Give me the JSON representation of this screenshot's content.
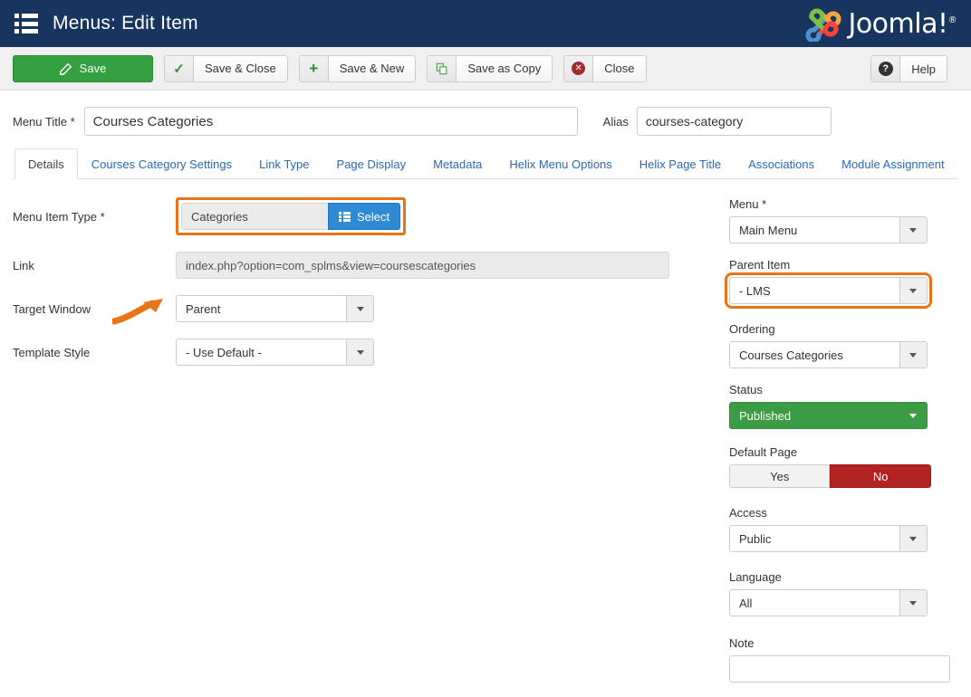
{
  "header": {
    "title": "Menus: Edit Item",
    "menu_icon": "list-icon",
    "brand": "Joomla!",
    "brand_mark": "®"
  },
  "toolbar": {
    "save": "Save",
    "save_close": "Save & Close",
    "save_new": "Save & New",
    "save_copy": "Save as Copy",
    "close": "Close",
    "help": "Help"
  },
  "form": {
    "menu_title_label": "Menu Title *",
    "menu_title_value": "Courses Categories",
    "alias_label": "Alias",
    "alias_value": "courses-category"
  },
  "tabs": [
    {
      "label": "Details",
      "active": true
    },
    {
      "label": "Courses Category Settings",
      "active": false
    },
    {
      "label": "Link Type",
      "active": false
    },
    {
      "label": "Page Display",
      "active": false
    },
    {
      "label": "Metadata",
      "active": false
    },
    {
      "label": "Helix Menu Options",
      "active": false
    },
    {
      "label": "Helix Page Title",
      "active": false
    },
    {
      "label": "Associations",
      "active": false
    },
    {
      "label": "Module Assignment",
      "active": false
    }
  ],
  "details": {
    "menu_item_type_label": "Menu Item Type *",
    "menu_item_type_value": "Categories",
    "select_button": "Select",
    "link_label": "Link",
    "link_value": "index.php?option=com_splms&view=coursescategories",
    "target_window_label": "Target Window",
    "target_window_value": "Parent",
    "template_style_label": "Template Style",
    "template_style_value": "- Use Default -"
  },
  "sidebar": {
    "menu_label": "Menu *",
    "menu_value": "Main Menu",
    "parent_label": "Parent Item",
    "parent_value": "- LMS",
    "ordering_label": "Ordering",
    "ordering_value": "Courses Categories",
    "status_label": "Status",
    "status_value": "Published",
    "default_page_label": "Default Page",
    "default_yes": "Yes",
    "default_no": "No",
    "access_label": "Access",
    "access_value": "Public",
    "language_label": "Language",
    "language_value": "All",
    "note_label": "Note",
    "note_value": "",
    "note_placeholder": ""
  },
  "colors": {
    "header_bg": "#17355e",
    "save_green": "#35a042",
    "select_blue": "#2e8ad4",
    "published_green": "#3c9b45",
    "no_red": "#b22222",
    "highlight_orange": "#e8741a",
    "tab_link_blue": "#2a6ab0"
  }
}
